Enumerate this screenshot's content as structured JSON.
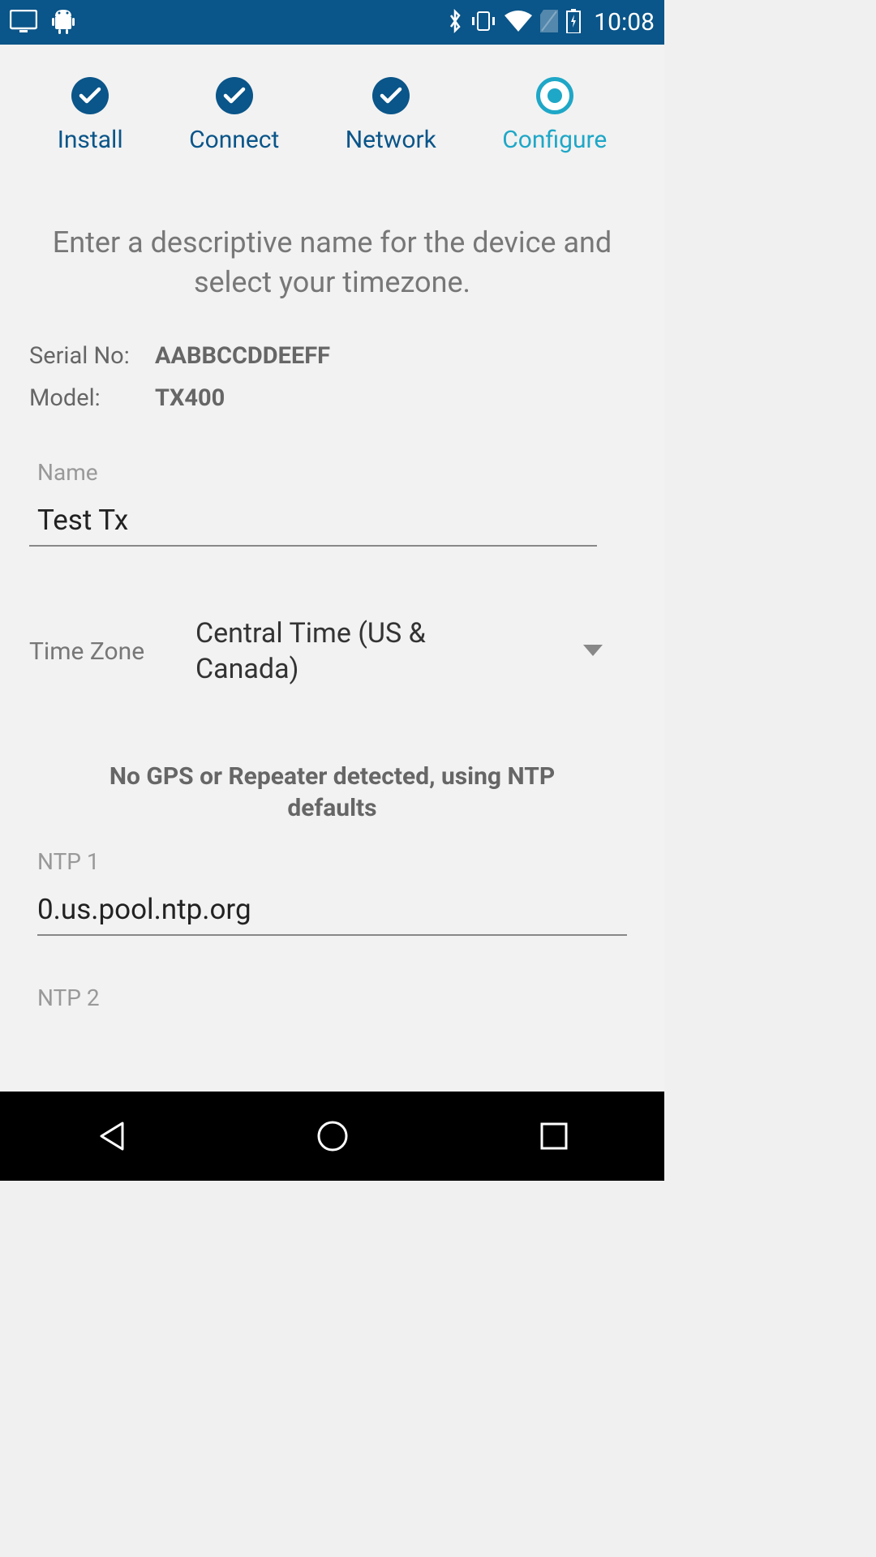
{
  "status_bar": {
    "time": "10:08"
  },
  "stepper": {
    "steps": [
      {
        "label": "Install",
        "state": "completed"
      },
      {
        "label": "Connect",
        "state": "completed"
      },
      {
        "label": "Network",
        "state": "completed"
      },
      {
        "label": "Configure",
        "state": "current"
      }
    ]
  },
  "instruction": "Enter a descriptive name for the device and select your timezone.",
  "info": {
    "serial_label": "Serial No:",
    "serial_value": "AABBCCDDEEFF",
    "model_label": "Model:",
    "model_value": "TX400"
  },
  "name_field": {
    "label": "Name",
    "value": "Test Tx"
  },
  "timezone": {
    "label": "Time Zone",
    "value": "Central Time (US & Canada)"
  },
  "ntp_notice": "No GPS or Repeater detected, using NTP defaults",
  "ntp1": {
    "label": "NTP 1",
    "value": "0.us.pool.ntp.org"
  },
  "ntp2": {
    "label": "NTP 2",
    "value": ""
  }
}
